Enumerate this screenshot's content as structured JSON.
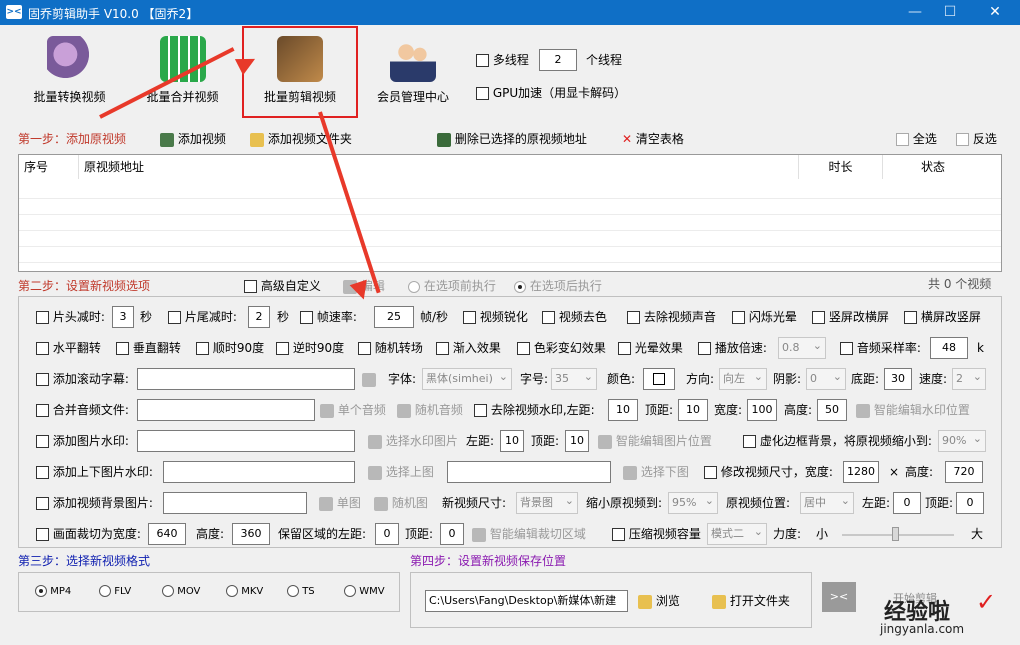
{
  "window": {
    "title": "固乔剪辑助手 V10.0  【固乔2】",
    "min": "—",
    "max": "☐",
    "close": "✕"
  },
  "toolbar": {
    "batch_convert": "批量转换视频",
    "batch_merge": "批量合并视频",
    "batch_edit": "批量剪辑视频",
    "member": "会员管理中心",
    "multithread": "多线程",
    "threads": "2",
    "threads_unit": "个线程",
    "gpu": "GPU加速（用显卡解码）"
  },
  "step1": {
    "label": "第一步：添加原视频",
    "add_video": "添加视频",
    "add_folder": "添加视频文件夹",
    "delete_selected": "删除已选择的原视频地址",
    "clear_table": "清空表格",
    "select_all": "全选",
    "invert": "反选"
  },
  "table": {
    "headers": [
      "序号",
      "原视频地址",
      "时长",
      "状态"
    ]
  },
  "step2": {
    "label": "第二步：设置新视频选项",
    "advanced": "高级自定义",
    "edit": "编辑",
    "before": "在选项前执行",
    "after": "在选项后执行",
    "count": "共 0 个视频"
  },
  "row1": {
    "head_cut": "片头减时:",
    "head_val": "3",
    "sec": "秒",
    "tail_cut": "片尾减时:",
    "tail_val": "2",
    "sec2": "秒",
    "fps": "帧速率:",
    "fps_val": "25",
    "fps_unit": "帧/秒",
    "sharpen": "视频锐化",
    "desat": "视频去色",
    "mute": "去除视频声音",
    "flash": "闪烁光晕",
    "v2h": "竖屏改横屏",
    "h2v": "横屏改竖屏"
  },
  "row2": {
    "hflip": "水平翻转",
    "vflip": "垂直翻转",
    "cw90": "顺时90度",
    "ccw90": "逆时90度",
    "rand_trans": "随机转场",
    "fade_in": "渐入效果",
    "color": "色彩变幻效果",
    "halo": "光晕效果",
    "speed": "播放倍速:",
    "speed_val": "0.8",
    "sample": "音频采样率:",
    "sample_val": "48",
    "k": "k"
  },
  "row3": {
    "scroll": "添加滚动字幕:",
    "font": "字体:",
    "font_val": "黑体(simhei)",
    "size": "字号:",
    "size_val": "35",
    "color": "颜色:",
    "dir": "方向:",
    "dir_val": "向左",
    "shadow": "阴影:",
    "shadow_val": "0",
    "bottom": "底距:",
    "bottom_val": "30",
    "spd": "速度:",
    "spd_val": "2"
  },
  "row4": {
    "merge_audio": "合并音频文件:",
    "single": "单个音频",
    "random": "随机音频",
    "remove_wm": "去除视频水印,左距:",
    "l": "10",
    "top": "顶距:",
    "t": "10",
    "w_lbl": "宽度:",
    "w": "100",
    "h_lbl": "高度:",
    "h": "50",
    "smart": "智能编辑水印位置"
  },
  "row5": {
    "img_wm": "添加图片水印:",
    "pick": "选择水印图片",
    "left": "左距:",
    "l": "10",
    "top": "顶距:",
    "t": "10",
    "smart": "智能编辑图片位置",
    "blur": "虚化边框背景，将原视频缩小到:",
    "blur_val": "90%"
  },
  "row6": {
    "tb_wm": "添加上下图片水印:",
    "pick_top": "选择上图",
    "pick_bottom": "选择下图",
    "resize": "修改视频尺寸，宽度:",
    "w": "1280",
    "x": "×",
    "h_lbl": "高度:",
    "h": "720"
  },
  "row7": {
    "bg": "添加视频背景图片:",
    "single": "单图",
    "random": "随机图",
    "size_lbl": "新视频尺寸:",
    "size_val": "背景图",
    "shrink": "缩小原视频到:",
    "shrink_val": "95%",
    "pos": "原视频位置:",
    "pos_val": "居中",
    "left": "左距:",
    "l": "0",
    "top": "顶距:",
    "t": "0"
  },
  "row8": {
    "crop": "画面裁切为宽度:",
    "w": "640",
    "h_lbl": "高度:",
    "h": "360",
    "keep": "保留区域的左距:",
    "l": "0",
    "top": "顶距:",
    "t": "0",
    "smart": "智能编辑裁切区域",
    "compress": "压缩视频容量",
    "mode": "模式二",
    "force": "力度:",
    "small": "小",
    "big": "大"
  },
  "step3": {
    "label": "第三步：选择新视频格式",
    "formats": [
      "MP4",
      "FLV",
      "MOV",
      "MKV",
      "TS",
      "WMV"
    ]
  },
  "step4": {
    "label": "第四步：设置新视频保存位置",
    "path": "C:\\Users\\Fang\\Desktop\\新媒体\\新建",
    "browse": "浏览",
    "open": "打开文件夹",
    "start": "开始剪辑"
  },
  "watermark": {
    "site": "经验啦",
    "url": "jingyanla.com"
  }
}
